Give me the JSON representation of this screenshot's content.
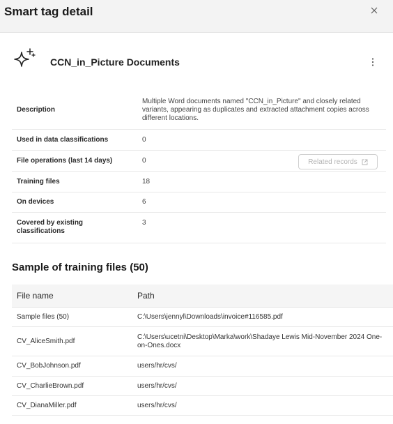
{
  "header": {
    "title": "Smart tag detail",
    "close_icon": "close-icon"
  },
  "tag": {
    "icon": "sparkle-icon",
    "name": "CCN_in_Picture Documents",
    "more_icon": "more-vertical-icon"
  },
  "details": {
    "description": {
      "label": "Description",
      "value": "Multiple Word documents named \"CCN_in_Picture\" and closely related variants, appearing as duplicates and extracted attachment copies across different locations."
    },
    "used_in_classifications": {
      "label": "Used in data classifications",
      "value": "0"
    },
    "file_operations": {
      "label": "File operations (last 14 days)",
      "value": "0",
      "button_label": "Related records",
      "button_icon": "external-link-icon"
    },
    "training_files": {
      "label": "Training files",
      "value": "18"
    },
    "on_devices": {
      "label": "On devices",
      "value": "6"
    },
    "covered": {
      "label": "Covered by existing classifications",
      "value": "3"
    }
  },
  "training": {
    "title": "Sample of training files (50)",
    "columns": {
      "file_name": "File name",
      "path": "Path"
    },
    "rows": [
      {
        "name": "Sample files (50)",
        "path": "C:\\Users\\jennyl\\Downloads\\invoice#116585.pdf"
      },
      {
        "name": "CV_AliceSmith.pdf",
        "path": "C:\\Users\\ucetni\\Desktop\\Marka\\work\\Shadaye Lewis Mid-November 2024 One-on-Ones.docx"
      },
      {
        "name": "CV_BobJohnson.pdf",
        "path": "users/hr/cvs/"
      },
      {
        "name": "CV_CharlieBrown.pdf",
        "path": "users/hr/cvs/"
      },
      {
        "name": "CV_DianaMiller.pdf",
        "path": "users/hr/cvs/"
      }
    ]
  }
}
